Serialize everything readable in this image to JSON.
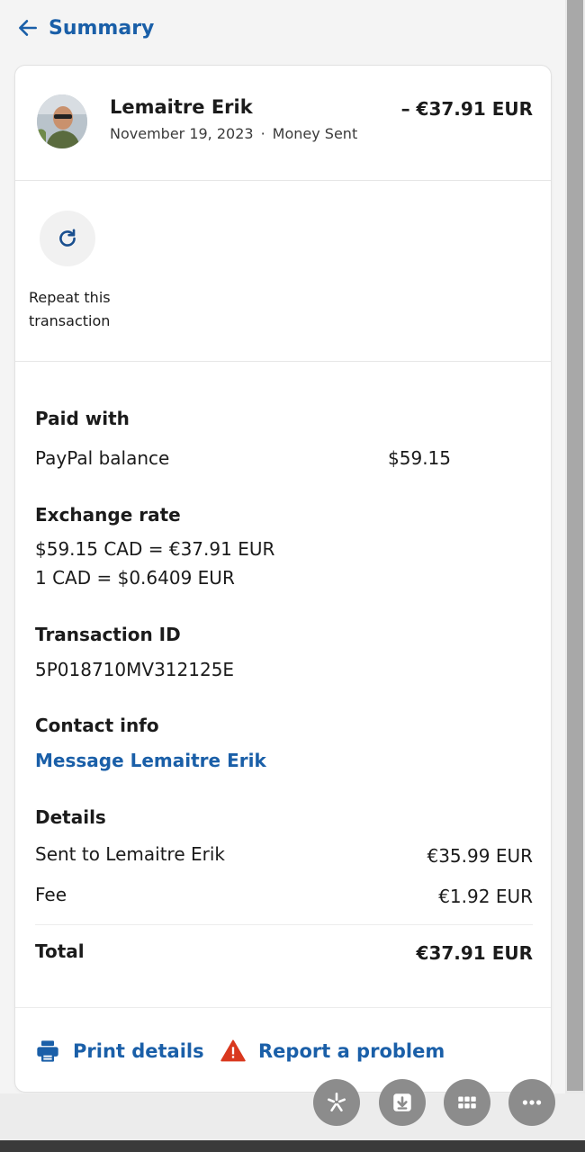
{
  "nav": {
    "back_label": "Summary"
  },
  "header": {
    "name": "Lemaitre Erik",
    "date": "November 19, 2023",
    "separator": "·",
    "type": "Money Sent",
    "amount": "– €37.91 EUR"
  },
  "repeat": {
    "label": "Repeat this transaction"
  },
  "paid_with": {
    "title": "Paid with",
    "method": "PayPal balance",
    "amount": "$59.15"
  },
  "exchange": {
    "title": "Exchange rate",
    "line1": "$59.15 CAD = €37.91 EUR",
    "line2": "1 CAD = $0.6409 EUR"
  },
  "transaction": {
    "title": "Transaction ID",
    "id": "5P018710MV312125E"
  },
  "contact": {
    "title": "Contact info",
    "link": "Message Lemaitre Erik"
  },
  "details": {
    "title": "Details",
    "sent_label": "Sent to Lemaitre Erik",
    "sent_amount": "€35.99 EUR",
    "fee_label": "Fee",
    "fee_amount": "€1.92 EUR",
    "total_label": "Total",
    "total_amount": "€37.91 EUR"
  },
  "actions": {
    "print": "Print details",
    "report": "Report a problem"
  },
  "icons": {
    "back": "arrow-left-icon",
    "repeat": "refresh-icon",
    "print": "printer-icon",
    "report": "warning-icon",
    "fab1": "magic-icon",
    "fab2": "download-icon",
    "fab3": "grid-icon",
    "fab4": "more-icon"
  },
  "colors": {
    "link": "#1a5fa8",
    "warning": "#d9381e",
    "fab": "#8c8c8c"
  }
}
